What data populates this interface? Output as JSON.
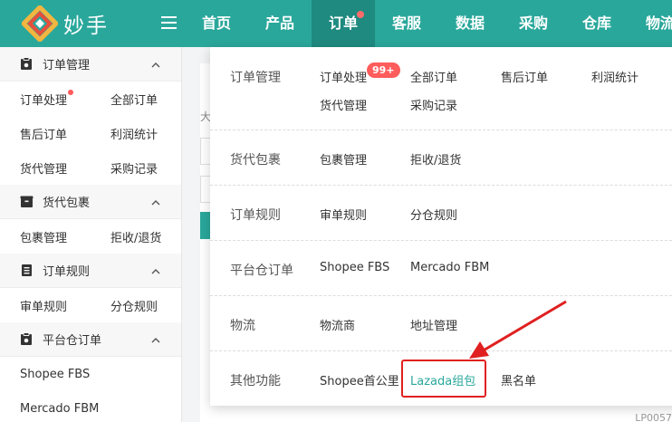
{
  "header": {
    "brand": "妙手",
    "nav": [
      {
        "label": "首页",
        "active": false
      },
      {
        "label": "产品",
        "active": false
      },
      {
        "label": "订单",
        "active": true,
        "dot": true
      },
      {
        "label": "客服",
        "active": false
      },
      {
        "label": "数据",
        "active": false
      },
      {
        "label": "采购",
        "active": false
      },
      {
        "label": "仓库",
        "active": false
      },
      {
        "label": "物流",
        "active": false
      }
    ],
    "icons": {
      "menu": "hamburger-icon",
      "logo": "diamond-logo"
    }
  },
  "sidebar": {
    "groups": [
      {
        "title": "订单管理",
        "icon": "clipboard-gear-icon",
        "rows": [
          [
            "订单处理",
            "全部订单"
          ],
          [
            "售后订单",
            "利润统计"
          ],
          [
            "货代管理",
            "采购记录"
          ]
        ]
      },
      {
        "title": "货代包裹",
        "icon": "package-icon",
        "rows": [
          [
            "包裹管理",
            "拒收/退货"
          ]
        ]
      },
      {
        "title": "订单规则",
        "icon": "document-icon",
        "rows": [
          [
            "审单规则",
            "分仓规则"
          ]
        ]
      },
      {
        "title": "平台仓订单",
        "icon": "clipboard-gear-icon",
        "rows": [
          [
            "Shopee FBS"
          ],
          [
            "Mercado FBM"
          ]
        ]
      }
    ]
  },
  "main_bg": {
    "partial_label": "大",
    "footer_fragment": "LP0057"
  },
  "dropdown": {
    "rows": [
      {
        "category": "订单管理",
        "links": [
          "订单处理",
          "全部订单",
          "售后订单",
          "利润统计",
          "货代管理",
          "采购记录"
        ],
        "badge": "99+"
      },
      {
        "category": "货代包裹",
        "links": [
          "包裹管理",
          "拒收/退货"
        ]
      },
      {
        "category": "订单规则",
        "links": [
          "审单规则",
          "分仓规则"
        ]
      },
      {
        "category": "平台仓订单",
        "links": [
          "Shopee FBS",
          "Mercado FBM"
        ]
      },
      {
        "category": "物流",
        "links": [
          "物流商",
          "地址管理"
        ]
      },
      {
        "category": "其他功能",
        "links": [
          "Shopee首公里",
          "Lazada组包",
          "黑名单"
        ]
      }
    ],
    "highlighted": "Lazada组包"
  },
  "colors": {
    "brand": "#2aa79b",
    "nav_active": "#1f8a80",
    "badge": "#ff5c5c",
    "annotation": "#e02020"
  }
}
